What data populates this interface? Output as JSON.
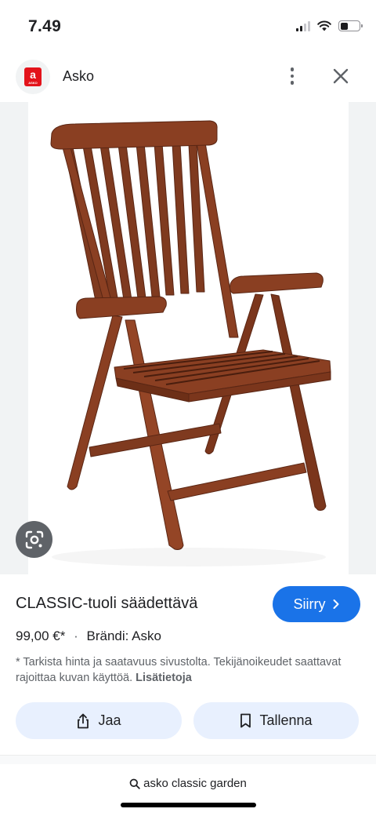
{
  "status_bar": {
    "time": "7.49"
  },
  "source": {
    "name": "Asko",
    "logo_letter": "a",
    "logo_text": "ASKO",
    "brand_color": "#e3131b"
  },
  "product": {
    "title": "CLASSIC-tuoli säädettävä",
    "price": "99,00 €*",
    "separator": "·",
    "brand": "Brändi: Asko",
    "disclaimer": "* Tarkista hinta ja saatavuus sivustolta. Tekijänoikeudet saattavat rajoittaa kuvan käyttöä.",
    "more_info": "Lisätietoja"
  },
  "actions": {
    "visit_label": "Siirry",
    "share_label": "Jaa",
    "save_label": "Tallenna"
  },
  "search": {
    "query": "asko classic garden"
  },
  "colors": {
    "accent": "#1a73e8",
    "action_bg": "#e8f0fe",
    "wood": "#8a3f22"
  }
}
